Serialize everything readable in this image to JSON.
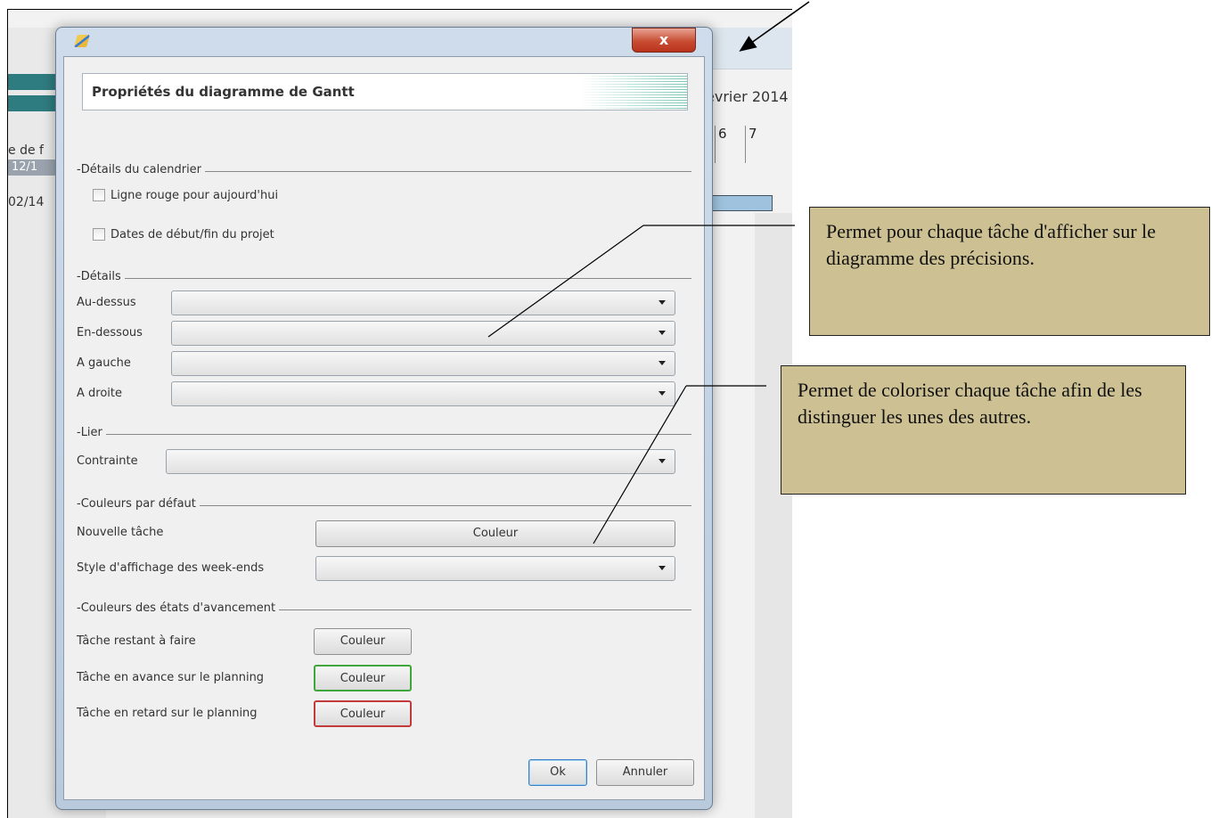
{
  "background": {
    "month_label": "evrier 2014",
    "left_label": "e de f",
    "left_date_1": "12/1",
    "left_date_2": "02/14",
    "day_cells": [
      "6",
      "7"
    ]
  },
  "dialog": {
    "close_glyph": "x",
    "header_title": "Propriétés du diagramme de Gantt",
    "calendar": {
      "legend": "-Détails du calendrier",
      "red_line_label": "Ligne rouge pour aujourd'hui",
      "project_dates_label": "Dates de début/fin du projet"
    },
    "details": {
      "legend": "-Détails",
      "above_label": "Au-dessus",
      "below_label": "En-dessous",
      "left_label": "A gauche",
      "right_label": "A droite"
    },
    "link": {
      "legend": "-Lier",
      "constraint_label": "Contrainte"
    },
    "default_colors": {
      "legend": "-Couleurs par défaut",
      "new_task_label": "Nouvelle tâche",
      "color_button": "Couleur",
      "weekend_style_label": "Style d'affichage des week-ends"
    },
    "progress_colors": {
      "legend": "-Couleurs des états d'avancement",
      "remaining_label": "Tâche restant à faire",
      "ahead_label": "Tâche en avance sur le planning",
      "late_label": "Tâche en retard sur le planning",
      "color_button": "Couleur"
    },
    "ok_button": "Ok",
    "cancel_button": "Annuler"
  },
  "callouts": {
    "details_note": "Permet pour chaque tâche d'afficher sur le diagramme des précisions.",
    "color_note": "Permet de coloriser chaque tâche afin de les distinguer les unes des autres."
  },
  "colors": {
    "callout_fill": "#cdc194",
    "ahead_border": "#3ea63a",
    "late_border": "#c33a3a"
  }
}
